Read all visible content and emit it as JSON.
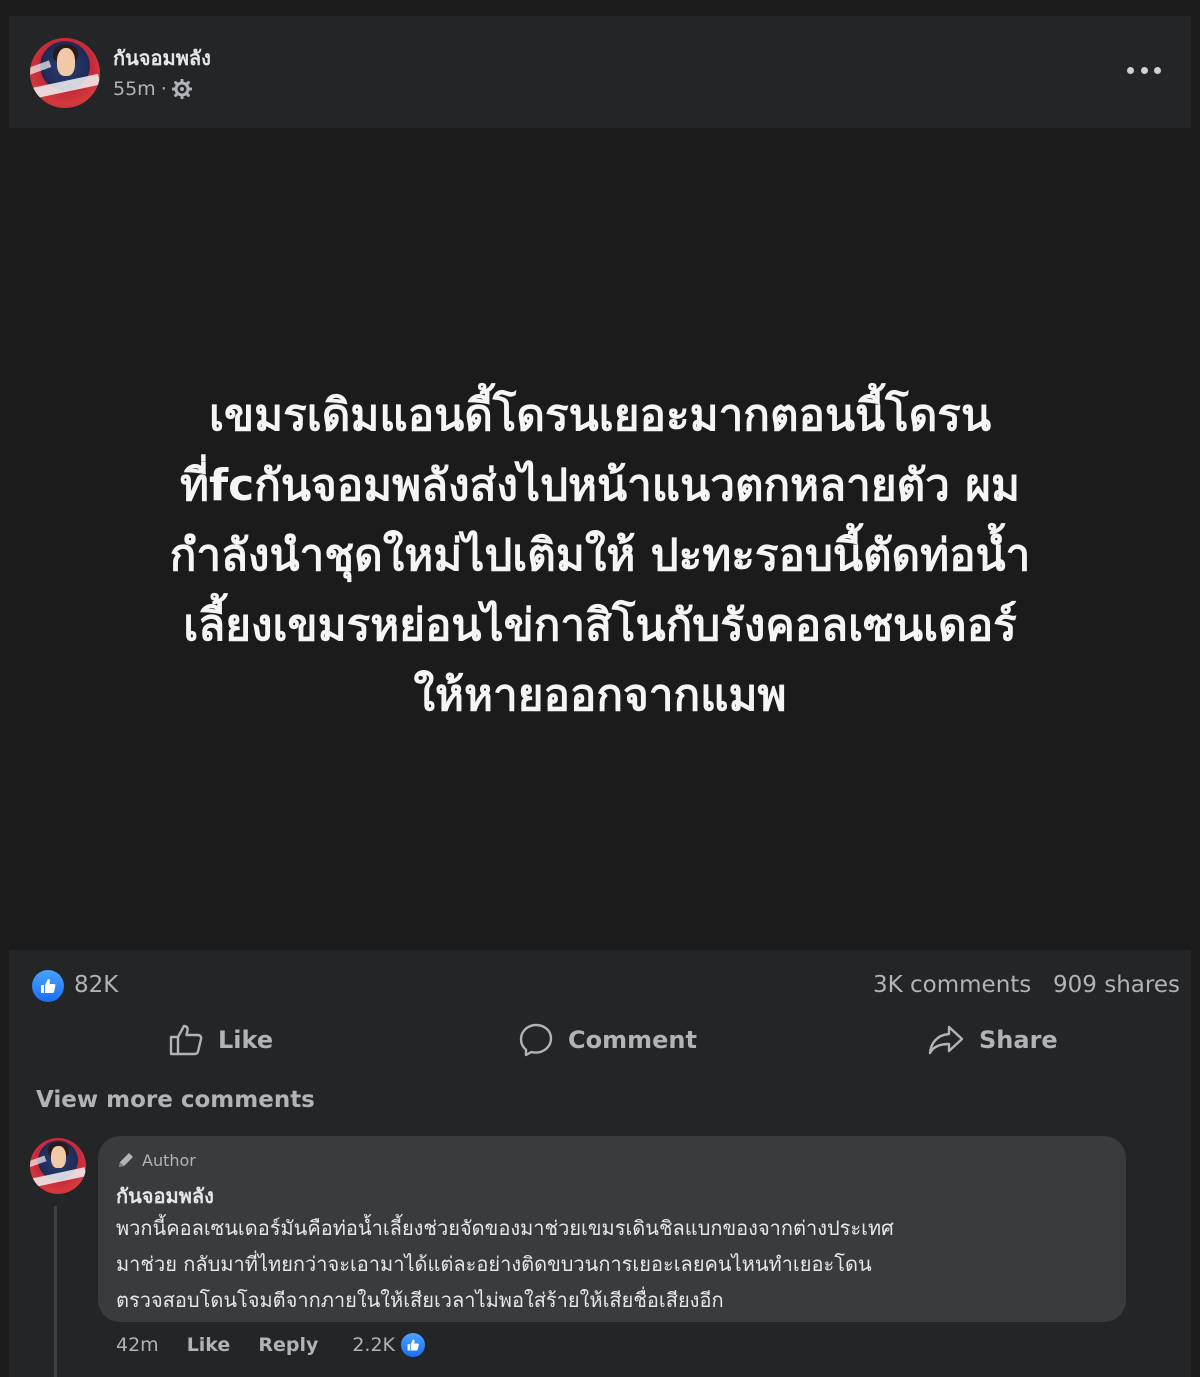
{
  "post": {
    "author": "กันจอมพลัง",
    "time": "55m",
    "separator": "·",
    "text": "เขมรเดิมแอนดี้โดรนเยอะมากตอนนี้โดรน\nที่fcกันจอมพลังส่งไปหน้าแนวตกหลายตัว ผม\nกำลังนำชุดใหม่ไปเติมให้ ปะทะรอบนี้ตัดท่อน้ำ\nเลี้ยงเขมรหย่อนไข่กาสิโนกับรังคอลเซนเดอร์\nให้หายออกจากแมพ"
  },
  "stats": {
    "reactions": "82K",
    "comments": "3K comments",
    "shares": "909 shares"
  },
  "actions": {
    "like": "Like",
    "comment": "Comment",
    "share": "Share"
  },
  "view_more": "View more comments",
  "comment": {
    "badge": "Author",
    "author": "กันจอมพลัง",
    "text": "พวกนี้คอลเซนเดอร์มันคือท่อน้ำเลี้ยงช่วยจัดของมาช่วยเขมรเดินชิลแบกของจากต่างประเทศ\nมาช่วย กลับมาที่ไทยกว่าจะเอามาได้แต่ละอย่างติดขบวนการเยอะเลยคนไหนทำเยอะโดน\nตรวจสอบโดนโจมตีจากภายในให้เสียเวลาไม่พอใส่ร้ายให้เสียชื่อเสียงอีก",
    "time": "42m",
    "like": "Like",
    "reply": "Reply",
    "reactions": "2.2K"
  },
  "colors": {
    "background": "#1c1c1d",
    "card": "#242526",
    "bubble": "#3a3b3c",
    "accent": "#1a6ef2",
    "secondary_text": "#b0b3b8"
  },
  "icons": [
    "gear-icon",
    "more-icon",
    "like-icon",
    "comment-icon",
    "share-icon",
    "pencil-icon"
  ]
}
